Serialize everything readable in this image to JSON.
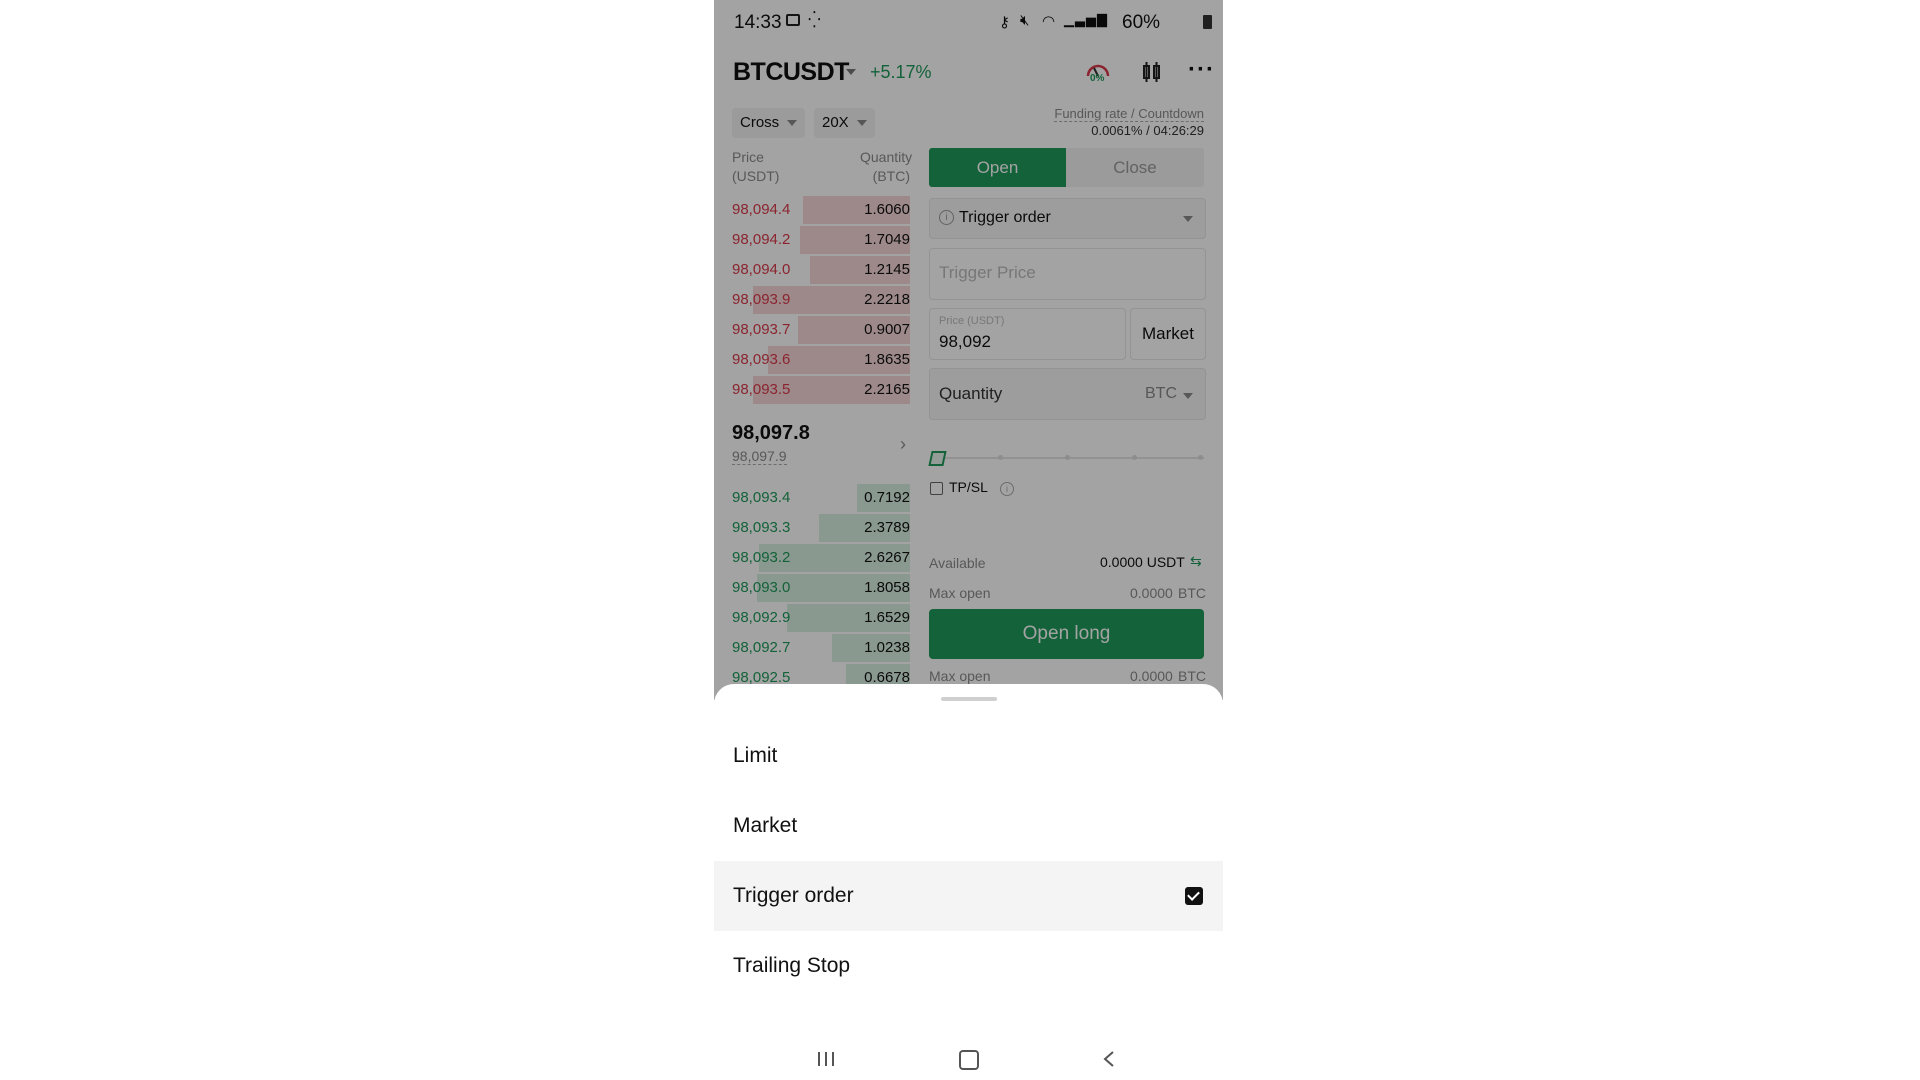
{
  "status_bar": {
    "time": "14:33",
    "battery": "60%"
  },
  "header": {
    "symbol": "BTCUSDT",
    "change": "+5.17%",
    "gauge_label": "0%"
  },
  "controls": {
    "margin_mode": "Cross",
    "leverage": "20X",
    "funding_label": "Funding rate / Countdown",
    "funding_value": "0.0061% / 04:26:29"
  },
  "orderbook": {
    "price_header": "Price\n(USDT)",
    "price_header_l1": "Price",
    "price_header_l2": "(USDT)",
    "qty_header_l1": "Quantity",
    "qty_header_l2": "(BTC)",
    "asks": [
      {
        "price": "98,094.4",
        "qty": "1.6060",
        "depth": 0.6
      },
      {
        "price": "98,094.2",
        "qty": "1.7049",
        "depth": 0.62
      },
      {
        "price": "98,094.0",
        "qty": "1.2145",
        "depth": 0.56
      },
      {
        "price": "98,093.9",
        "qty": "2.2218",
        "depth": 0.88
      },
      {
        "price": "98,093.7",
        "qty": "0.9007",
        "depth": 0.63
      },
      {
        "price": "98,093.6",
        "qty": "1.8635",
        "depth": 0.8
      },
      {
        "price": "98,093.5",
        "qty": "2.2165",
        "depth": 0.88
      }
    ],
    "last_price": "98,097.8",
    "mark_price": "98,097.9",
    "bids": [
      {
        "price": "98,093.4",
        "qty": "0.7192",
        "depth": 0.3
      },
      {
        "price": "98,093.3",
        "qty": "2.3789",
        "depth": 0.51
      },
      {
        "price": "98,093.2",
        "qty": "2.6267",
        "depth": 0.85
      },
      {
        "price": "98,093.0",
        "qty": "1.8058",
        "depth": 0.86
      },
      {
        "price": "98,092.9",
        "qty": "1.6529",
        "depth": 0.69
      },
      {
        "price": "98,092.7",
        "qty": "1.0238",
        "depth": 0.44
      },
      {
        "price": "98,092.5",
        "qty": "0.6678",
        "depth": 0.36
      }
    ]
  },
  "trade_panel": {
    "tab_open": "Open",
    "tab_close": "Close",
    "order_type": "Trigger order",
    "trigger_price_placeholder": "Trigger Price",
    "price_label": "Price (USDT)",
    "price_value": "98,092",
    "market_button": "Market",
    "quantity_label": "Quantity",
    "quantity_unit": "BTC",
    "tpsl_label": "TP/SL",
    "available_label": "Available",
    "available_value": "0.0000 USDT",
    "max_open_label": "Max open",
    "max_open_value": "0.0000",
    "max_open_unit": "BTC",
    "open_long_button": "Open long",
    "max_open_label_2": "Max open",
    "max_open_value_2": "0.0000",
    "max_open_unit_2": "BTC"
  },
  "order_type_sheet": {
    "options": [
      "Limit",
      "Market",
      "Trigger order",
      "Trailing Stop"
    ],
    "selected_index": 2
  },
  "colors": {
    "accent_green": "#1e9a5a",
    "ask_red": "#d9394a",
    "bid_green": "#1e9a5a"
  },
  "icons": [
    "image-icon",
    "sparkle-icon",
    "key-icon",
    "mute-icon",
    "wifi-icon",
    "signal-icon",
    "battery-icon",
    "gauge-icon",
    "candlestick-icon",
    "more-icon",
    "info-icon",
    "transfer-icon",
    "chevron-right-icon",
    "recent-apps-icon",
    "home-icon",
    "back-icon"
  ]
}
